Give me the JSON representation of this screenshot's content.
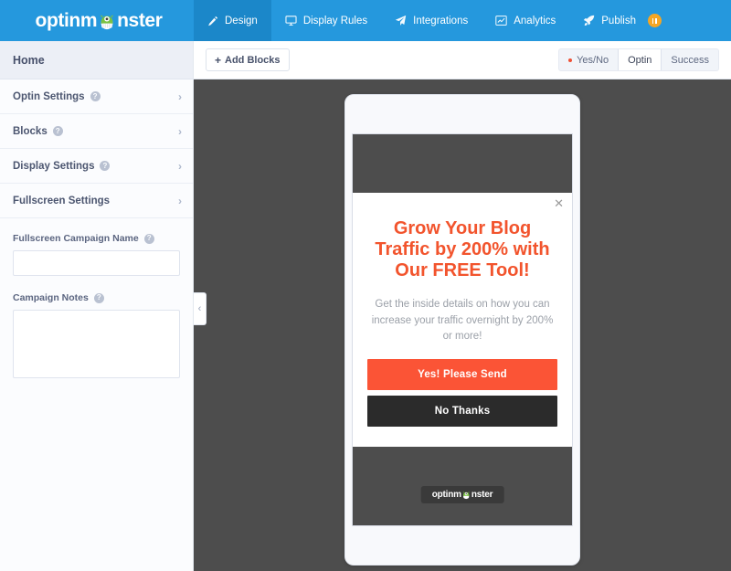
{
  "header": {
    "brand": "optinmonster",
    "brand_pre": "optinm",
    "brand_post": "nster",
    "brand_color": "#2598dd",
    "nav": [
      {
        "label": "Design",
        "icon": "pencil-icon",
        "active": true
      },
      {
        "label": "Display Rules",
        "icon": "monitor-icon",
        "active": false
      },
      {
        "label": "Integrations",
        "icon": "plane-icon",
        "active": false
      },
      {
        "label": "Analytics",
        "icon": "chart-line-icon",
        "active": false
      },
      {
        "label": "Publish",
        "icon": "rocket-icon",
        "active": false,
        "badge": "pause-badge"
      }
    ]
  },
  "sidebar": {
    "home_label": "Home",
    "accordion": [
      {
        "label": "Optin Settings",
        "help": true,
        "chevron": "›"
      },
      {
        "label": "Blocks",
        "help": true,
        "chevron": "›"
      },
      {
        "label": "Display Settings",
        "help": true,
        "chevron": "›"
      },
      {
        "label": "Fullscreen Settings",
        "help": false,
        "chevron": "›"
      }
    ],
    "fields": {
      "campaign_name_label": "Fullscreen Campaign Name",
      "campaign_name_value": "",
      "campaign_name_placeholder": "",
      "campaign_notes_label": "Campaign Notes",
      "campaign_notes_value": "",
      "campaign_notes_placeholder": ""
    },
    "help_glyph": "?"
  },
  "toolbar": {
    "add_blocks_label": "Add Blocks",
    "add_blocks_plus": "+",
    "views": [
      {
        "label": "Yes/No",
        "active": false,
        "dot": true
      },
      {
        "label": "Optin",
        "active": true,
        "dot": false
      },
      {
        "label": "Success",
        "active": false,
        "dot": false
      }
    ]
  },
  "canvas": {
    "collapse_glyph": "‹",
    "background": "#4d4d4d"
  },
  "optin": {
    "close_glyph": "✕",
    "headline": "Grow Your Blog Traffic by 200% with Our FREE Tool!",
    "headline_color": "#f2542d",
    "subtext": "Get the inside details on how you can increase your traffic overnight by 200% or more!",
    "primary_button": "Yes! Please Send",
    "primary_button_color": "#fb5436",
    "secondary_button": "No Thanks",
    "secondary_button_color": "#2b2b2b",
    "badge_pre": "optinm",
    "badge_post": "nster"
  }
}
